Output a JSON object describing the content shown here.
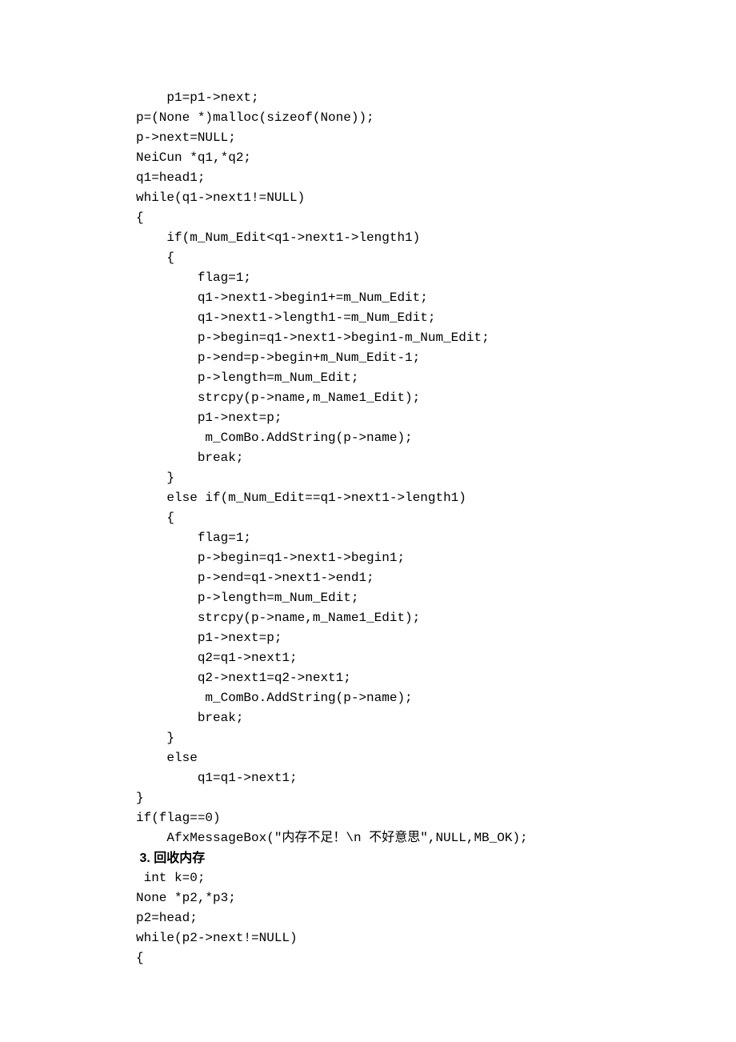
{
  "code1": [
    "    p1=p1->next;",
    "p=(None *)malloc(sizeof(None));",
    "p->next=NULL;",
    "NeiCun *q1,*q2;",
    "q1=head1;",
    "while(q1->next1!=NULL)",
    "{",
    "    if(m_Num_Edit<q1->next1->length1)",
    "    {",
    "        flag=1;",
    "        q1->next1->begin1+=m_Num_Edit;",
    "        q1->next1->length1-=m_Num_Edit;",
    "        p->begin=q1->next1->begin1-m_Num_Edit;",
    "        p->end=p->begin+m_Num_Edit-1;",
    "        p->length=m_Num_Edit;",
    "        strcpy(p->name,m_Name1_Edit);",
    "        p1->next=p;",
    "         m_ComBo.AddString(p->name);",
    "        break;",
    "    }",
    "    else if(m_Num_Edit==q1->next1->length1)",
    "    {",
    "        flag=1;",
    "        p->begin=q1->next1->begin1;",
    "        p->end=q1->next1->end1;",
    "        p->length=m_Num_Edit;",
    "        strcpy(p->name,m_Name1_Edit);",
    "        p1->next=p;",
    "        q2=q1->next1;",
    "        q2->next1=q2->next1;",
    "         m_ComBo.AddString(p->name);",
    "        break;",
    "    }",
    "    else",
    "        q1=q1->next1;",
    "}",
    "if(flag==0)",
    "    AfxMessageBox(\"内存不足！\\n 不好意思\",NULL,MB_OK);"
  ],
  "heading": " 3. 回收内存",
  "code2": [
    " int k=0;",
    "None *p2,*p3;",
    "p2=head;",
    "while(p2->next!=NULL)",
    "{"
  ]
}
